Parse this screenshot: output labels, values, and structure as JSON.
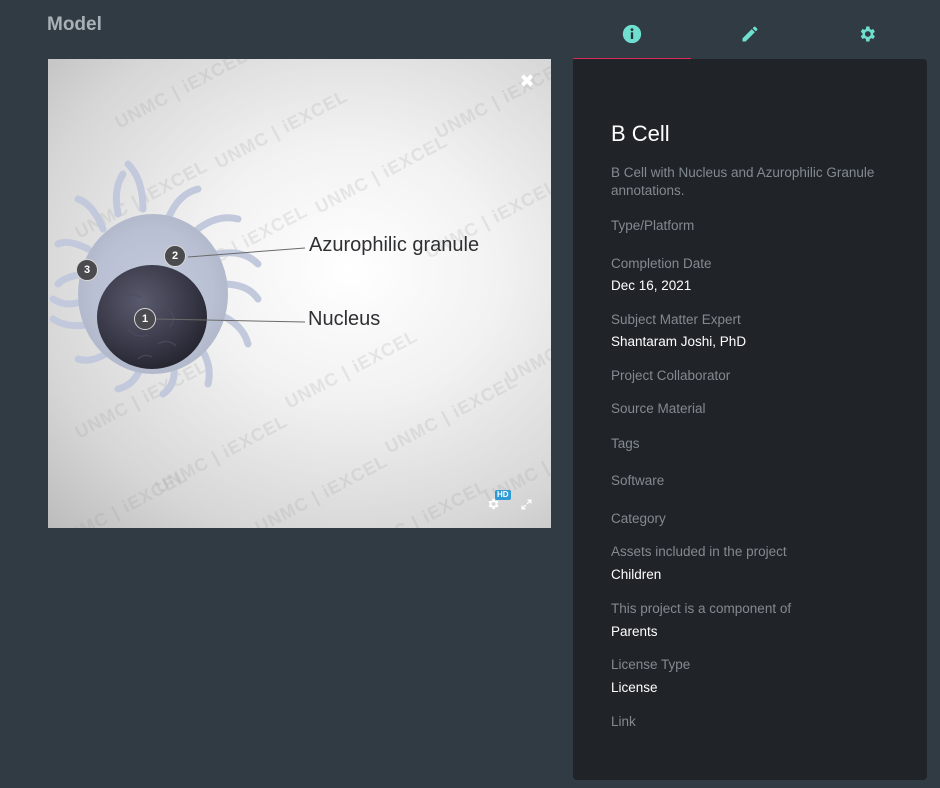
{
  "header": {
    "title": "Model"
  },
  "tabs": [
    {
      "name": "info",
      "icon": "info-icon"
    },
    {
      "name": "edit",
      "icon": "pencil-icon"
    },
    {
      "name": "settings",
      "icon": "gear-icon"
    }
  ],
  "accent_color": "#6fe0d0",
  "active_tab_color": "#d42d5a",
  "viewer": {
    "watermark": "UNMC | iEXCEL",
    "hotspots": [
      "1",
      "2",
      "3"
    ],
    "annotations": {
      "azurophilic": "Azurophilic granule",
      "nucleus": "Nucleus"
    },
    "close_glyph": "✖",
    "hd_badge": "HD"
  },
  "details": {
    "title": "B Cell",
    "description": "B Cell with Nucleus and Azurophilic Granule annotations.",
    "type_platform_label": "Type/Platform",
    "completion_date_label": "Completion Date",
    "completion_date": "Dec 16, 2021",
    "sme_label": "Subject Matter Expert",
    "sme": "Shantaram Joshi, PhD",
    "collaborator_label": "Project Collaborator",
    "source_label": "Source Material",
    "tags_label": "Tags",
    "software_label": "Software",
    "category_label": "Category",
    "assets_label": "Assets included in the project",
    "assets": "Children",
    "component_label": "This project is a component of",
    "component": "Parents",
    "license_type_label": "License Type",
    "license": "License",
    "link_label": "Link"
  }
}
